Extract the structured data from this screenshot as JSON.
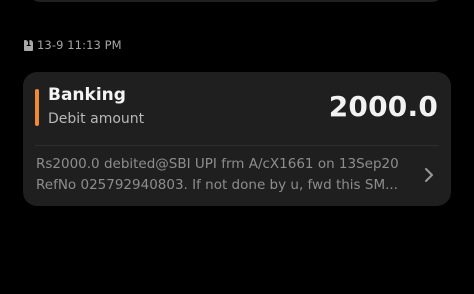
{
  "timestamp": {
    "sim_label": "1",
    "text": "13-9 11:13 PM"
  },
  "transaction": {
    "category": "Banking",
    "type_label": "Debit amount",
    "amount": "2000.0",
    "accent_color": "#f0883a"
  },
  "sms": {
    "line1": "Rs2000.0 debited@SBI UPI frm A/cX1661 on 13Sep20",
    "line2": "RefNo 025792940803. If not done by u, fwd this SM..."
  },
  "icons": {
    "sim": "sim-card-icon",
    "chevron": "chevron-right-icon"
  }
}
